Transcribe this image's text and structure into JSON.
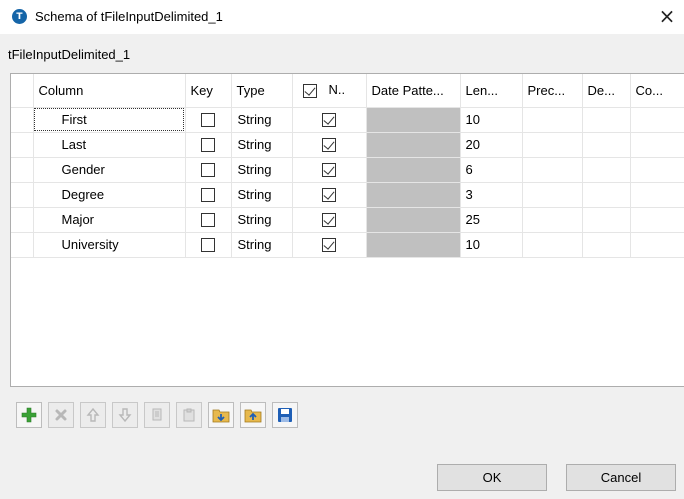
{
  "window": {
    "title": "Schema of tFileInputDelimited_1",
    "icon_letter": "T",
    "close_glyph": "×"
  },
  "component_label": "tFileInputDelimited_1",
  "table": {
    "headers": {
      "column": "Column",
      "key": "Key",
      "type": "Type",
      "nullable": "N..",
      "date_pattern": "Date Patte...",
      "length": "Len...",
      "precision": "Prec...",
      "default": "De...",
      "comment": "Co..."
    },
    "header_nullable_checked": true,
    "rows": [
      {
        "name": "First",
        "key": false,
        "type": "String",
        "nullable": true,
        "date_pattern": "",
        "length": "10",
        "precision": "",
        "default": "",
        "comment": ""
      },
      {
        "name": "Last",
        "key": false,
        "type": "String",
        "nullable": true,
        "date_pattern": "",
        "length": "20",
        "precision": "",
        "default": "",
        "comment": ""
      },
      {
        "name": "Gender",
        "key": false,
        "type": "String",
        "nullable": true,
        "date_pattern": "",
        "length": "6",
        "precision": "",
        "default": "",
        "comment": ""
      },
      {
        "name": "Degree",
        "key": false,
        "type": "String",
        "nullable": true,
        "date_pattern": "",
        "length": "3",
        "precision": "",
        "default": "",
        "comment": ""
      },
      {
        "name": "Major",
        "key": false,
        "type": "String",
        "nullable": true,
        "date_pattern": "",
        "length": "25",
        "precision": "",
        "default": "",
        "comment": ""
      },
      {
        "name": "University",
        "key": false,
        "type": "String",
        "nullable": true,
        "date_pattern": "",
        "length": "10",
        "precision": "",
        "default": "",
        "comment": ""
      }
    ]
  },
  "toolbar": {
    "buttons": [
      {
        "name": "add-icon",
        "enabled": true
      },
      {
        "name": "remove-icon",
        "enabled": false
      },
      {
        "name": "move-up-icon",
        "enabled": false
      },
      {
        "name": "move-down-icon",
        "enabled": false
      },
      {
        "name": "copy-icon",
        "enabled": false
      },
      {
        "name": "paste-icon",
        "enabled": false
      },
      {
        "name": "import-schema-icon",
        "enabled": true
      },
      {
        "name": "export-schema-icon",
        "enabled": true
      },
      {
        "name": "save-icon",
        "enabled": true
      }
    ]
  },
  "buttons": {
    "ok": "OK",
    "cancel": "Cancel"
  },
  "colors": {
    "date_pattern_cell": "#c0c0c0",
    "add_icon": "#3aa136",
    "folder_icon": "#e7b94d",
    "save_icon": "#1f5fb6"
  }
}
